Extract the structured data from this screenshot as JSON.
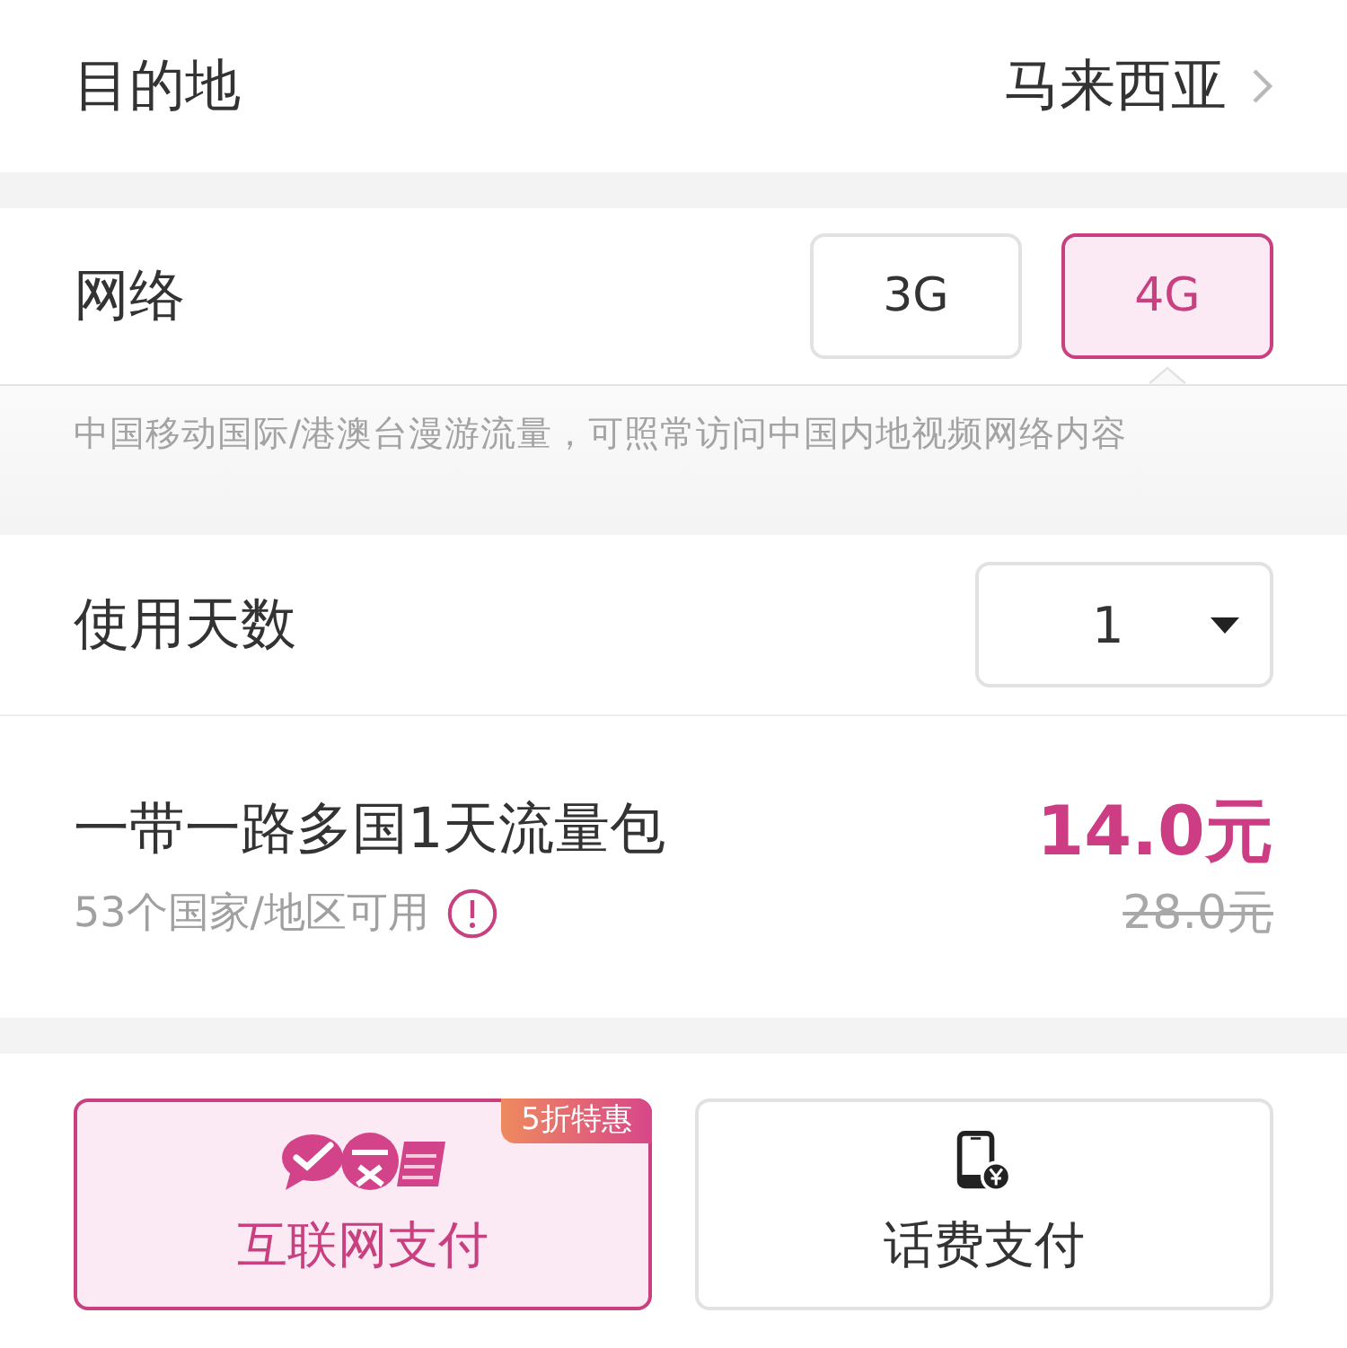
{
  "destination": {
    "label": "目的地",
    "value": "马来西亚"
  },
  "network": {
    "label": "网络",
    "options": [
      {
        "label": "3G",
        "selected": false
      },
      {
        "label": "4G",
        "selected": true
      }
    ],
    "note": "中国移动国际/港澳台漫游流量，可照常访问中国内地视频网络内容"
  },
  "days": {
    "label": "使用天数",
    "value": "1"
  },
  "package": {
    "title": "一带一路多国1天流量包",
    "coverage": "53个国家/地区可用",
    "price": "14.0元",
    "original_price": "28.0元"
  },
  "payment_methods": [
    {
      "kind": "online",
      "label": "互联网支付",
      "selected": true,
      "badge": "5折特惠"
    },
    {
      "kind": "phone_bill",
      "label": "话费支付",
      "selected": false
    }
  ]
}
